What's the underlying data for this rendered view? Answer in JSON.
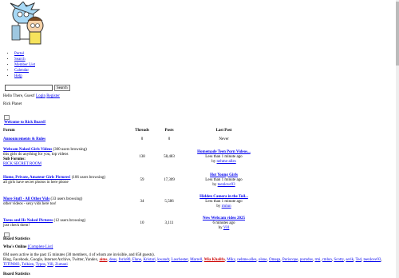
{
  "nav": [
    "Portal",
    "Search",
    "Member List",
    "Calendar",
    "Help"
  ],
  "search_button": "Search",
  "welcome": {
    "text": "Hello There, Guest!",
    "login": "Login",
    "register": "Register"
  },
  "site_name": "Rick Planet",
  "forum_category": "Welcome to Rick Board!",
  "columns": {
    "forum": "Forum",
    "threads": "Threads",
    "posts": "Posts",
    "last": "Last Post"
  },
  "forums": [
    {
      "title": "Announcements & Rules",
      "threads": "0",
      "posts": "0",
      "last": "Never"
    },
    {
      "title": "Webcam Naked Girls Videos",
      "browsing": "(300 users browsing)",
      "desc": "this girls do anything for you, top videos",
      "subhead": "Sub Forums:",
      "sub": "RICK SECRET ROOM",
      "threads": "138",
      "posts": "58,483",
      "last_title": "Homemade Teen Porn Videos...",
      "last_time": "Less than 1 minute ago",
      "last_by": "by ",
      "last_user": "nehme-alles"
    },
    {
      "title": "Home, Private, Amateur Girls Pictures!",
      "browsing": "(106 users browsing)",
      "desc": "all girls have secret photos in here phone",
      "threads": "59",
      "posts": "17,309",
      "last_title": "Hot Young Girls",
      "last_time": "Less than 1 minute ago",
      "last_by": "by ",
      "last_user": "teenlove93"
    },
    {
      "title": "More Stuff - All Other Vids",
      "browsing": "(33 users browsing)",
      "desc": "other videos - sexy vids here too!",
      "threads": "34",
      "posts": "5,586",
      "last_title": "Hidden Camera in the Toil...",
      "last_time": "Less than 1 minute ago",
      "last_by": "by ",
      "last_user": "rmlun"
    },
    {
      "title": "Teens and Hs Naked Pictures",
      "browsing": "(12 users browsing)",
      "desc": "just check them!",
      "threads": "10",
      "posts": "3,111",
      "last_title": "New Webcam video 2025",
      "last_time": "6 minutes ago",
      "last_by": "by ",
      "last_user": "Vill"
    }
  ],
  "stats": {
    "title": "Board Statistics",
    "who": "Who's Online",
    "complete": "[Complete List]",
    "count": "694 users active in the past 15 minutes (30 members, 4 of whom are invisible, and 658 guests).",
    "bots": "Bing, Facebook, Google, Internet Archive, Twitter, Yandex,",
    "users": [
      "aims",
      "deus",
      "forix80",
      "Flane",
      "Kristari",
      "kwandr",
      "Laschester",
      "Marrell",
      "Mia Khalifa",
      "Miky",
      "nehme-alles",
      "olsne",
      "Omega",
      "Periscope",
      "porndus",
      "rmi",
      "rmlun",
      "Scotty",
      "serik",
      "Ted",
      "teenlove93",
      "TITIN083",
      "Tolkien",
      "Typos",
      "Vill",
      "Zumani"
    ],
    "bottom": "Board Statistics"
  },
  "colors": {
    "link": "#0000ee",
    "red_user": "#cc0000"
  }
}
